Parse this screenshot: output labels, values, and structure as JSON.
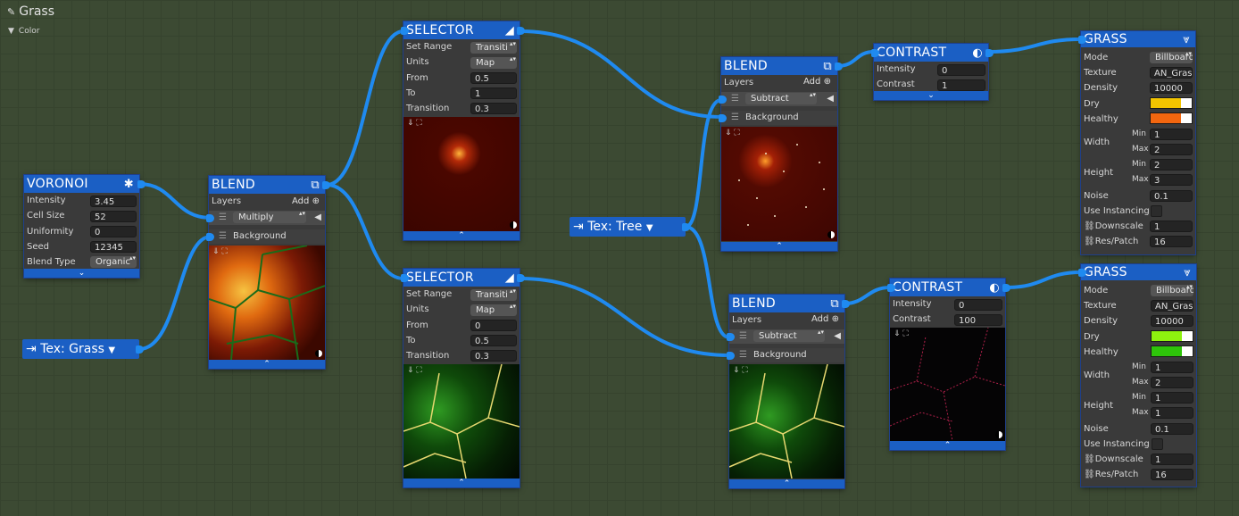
{
  "graph": {
    "title": "Grass",
    "color_label": "Color"
  },
  "voronoi": {
    "title": "VORONOI",
    "rows": [
      {
        "label": "Intensity",
        "value": "3.45"
      },
      {
        "label": "Cell Size",
        "value": "52"
      },
      {
        "label": "Uniformity",
        "value": "0"
      },
      {
        "label": "Seed",
        "value": "12345"
      },
      {
        "label": "Blend Type",
        "value": "Organic"
      }
    ]
  },
  "tex_grass": {
    "label": "Tex: Grass"
  },
  "tex_tree": {
    "label": "Tex: Tree"
  },
  "blend1": {
    "title": "BLEND",
    "layers_label": "Layers",
    "add_label": "Add",
    "layer_mode": "Multiply",
    "background_label": "Background"
  },
  "selector1": {
    "title": "SELECTOR",
    "rows": [
      {
        "label": "Set Range",
        "value": "Transiti"
      },
      {
        "label": "Units",
        "value": "Map"
      },
      {
        "label": "From",
        "value": "0.5"
      },
      {
        "label": "To",
        "value": "1"
      },
      {
        "label": "Transition",
        "value": "0.3"
      }
    ]
  },
  "selector2": {
    "title": "SELECTOR",
    "rows": [
      {
        "label": "Set Range",
        "value": "Transiti"
      },
      {
        "label": "Units",
        "value": "Map"
      },
      {
        "label": "From",
        "value": "0"
      },
      {
        "label": "To",
        "value": "0.5"
      },
      {
        "label": "Transition",
        "value": "0.3"
      }
    ]
  },
  "blend2": {
    "title": "BLEND",
    "layers_label": "Layers",
    "add_label": "Add",
    "layer_mode": "Subtract",
    "background_label": "Background"
  },
  "blend3": {
    "title": "BLEND",
    "layers_label": "Layers",
    "add_label": "Add",
    "layer_mode": "Subtract",
    "background_label": "Background"
  },
  "contrast1": {
    "title": "CONTRAST",
    "rows": [
      {
        "label": "Intensity",
        "value": "0"
      },
      {
        "label": "Contrast",
        "value": "1"
      }
    ]
  },
  "contrast2": {
    "title": "CONTRAST",
    "rows": [
      {
        "label": "Intensity",
        "value": "0"
      },
      {
        "label": "Contrast",
        "value": "100"
      }
    ]
  },
  "grass1": {
    "title": "GRASS",
    "mode_label": "Mode",
    "mode_value": "Billboard",
    "texture_label": "Texture",
    "texture_value": "AN_Gras",
    "density_label": "Density",
    "density_value": "10000",
    "dry_label": "Dry",
    "dry_color": "#f2c400",
    "healthy_label": "Healthy",
    "healthy_color": "#f2660f",
    "width_label": "Width",
    "height_label": "Height",
    "min_label": "Min",
    "max_label": "Max",
    "width_min": "1",
    "width_max": "2",
    "height_min": "2",
    "height_max": "3",
    "noise_label": "Noise",
    "noise_value": "0.1",
    "instancing_label": "Use Instancing",
    "downscale_label": "Downscale",
    "downscale_value": "1",
    "respatch_label": "Res/Patch",
    "respatch_value": "16"
  },
  "grass2": {
    "title": "GRASS",
    "mode_label": "Mode",
    "mode_value": "Billboard",
    "texture_label": "Texture",
    "texture_value": "AN_Gras",
    "density_label": "Density",
    "density_value": "10000",
    "dry_label": "Dry",
    "dry_color": "#8ef20f",
    "healthy_label": "Healthy",
    "healthy_color": "#2ec40a",
    "width_label": "Width",
    "height_label": "Height",
    "min_label": "Min",
    "max_label": "Max",
    "width_min": "1",
    "width_max": "2",
    "height_min": "1",
    "height_max": "1",
    "noise_label": "Noise",
    "noise_value": "0.1",
    "instancing_label": "Use Instancing",
    "downscale_label": "Downscale",
    "downscale_value": "1",
    "respatch_label": "Res/Patch",
    "respatch_value": "16"
  },
  "colors": {
    "accent": "#1b5fc4",
    "wire": "#1f8af0",
    "node_bg": "#3a3a3a",
    "canvas": "#3c4a33"
  }
}
